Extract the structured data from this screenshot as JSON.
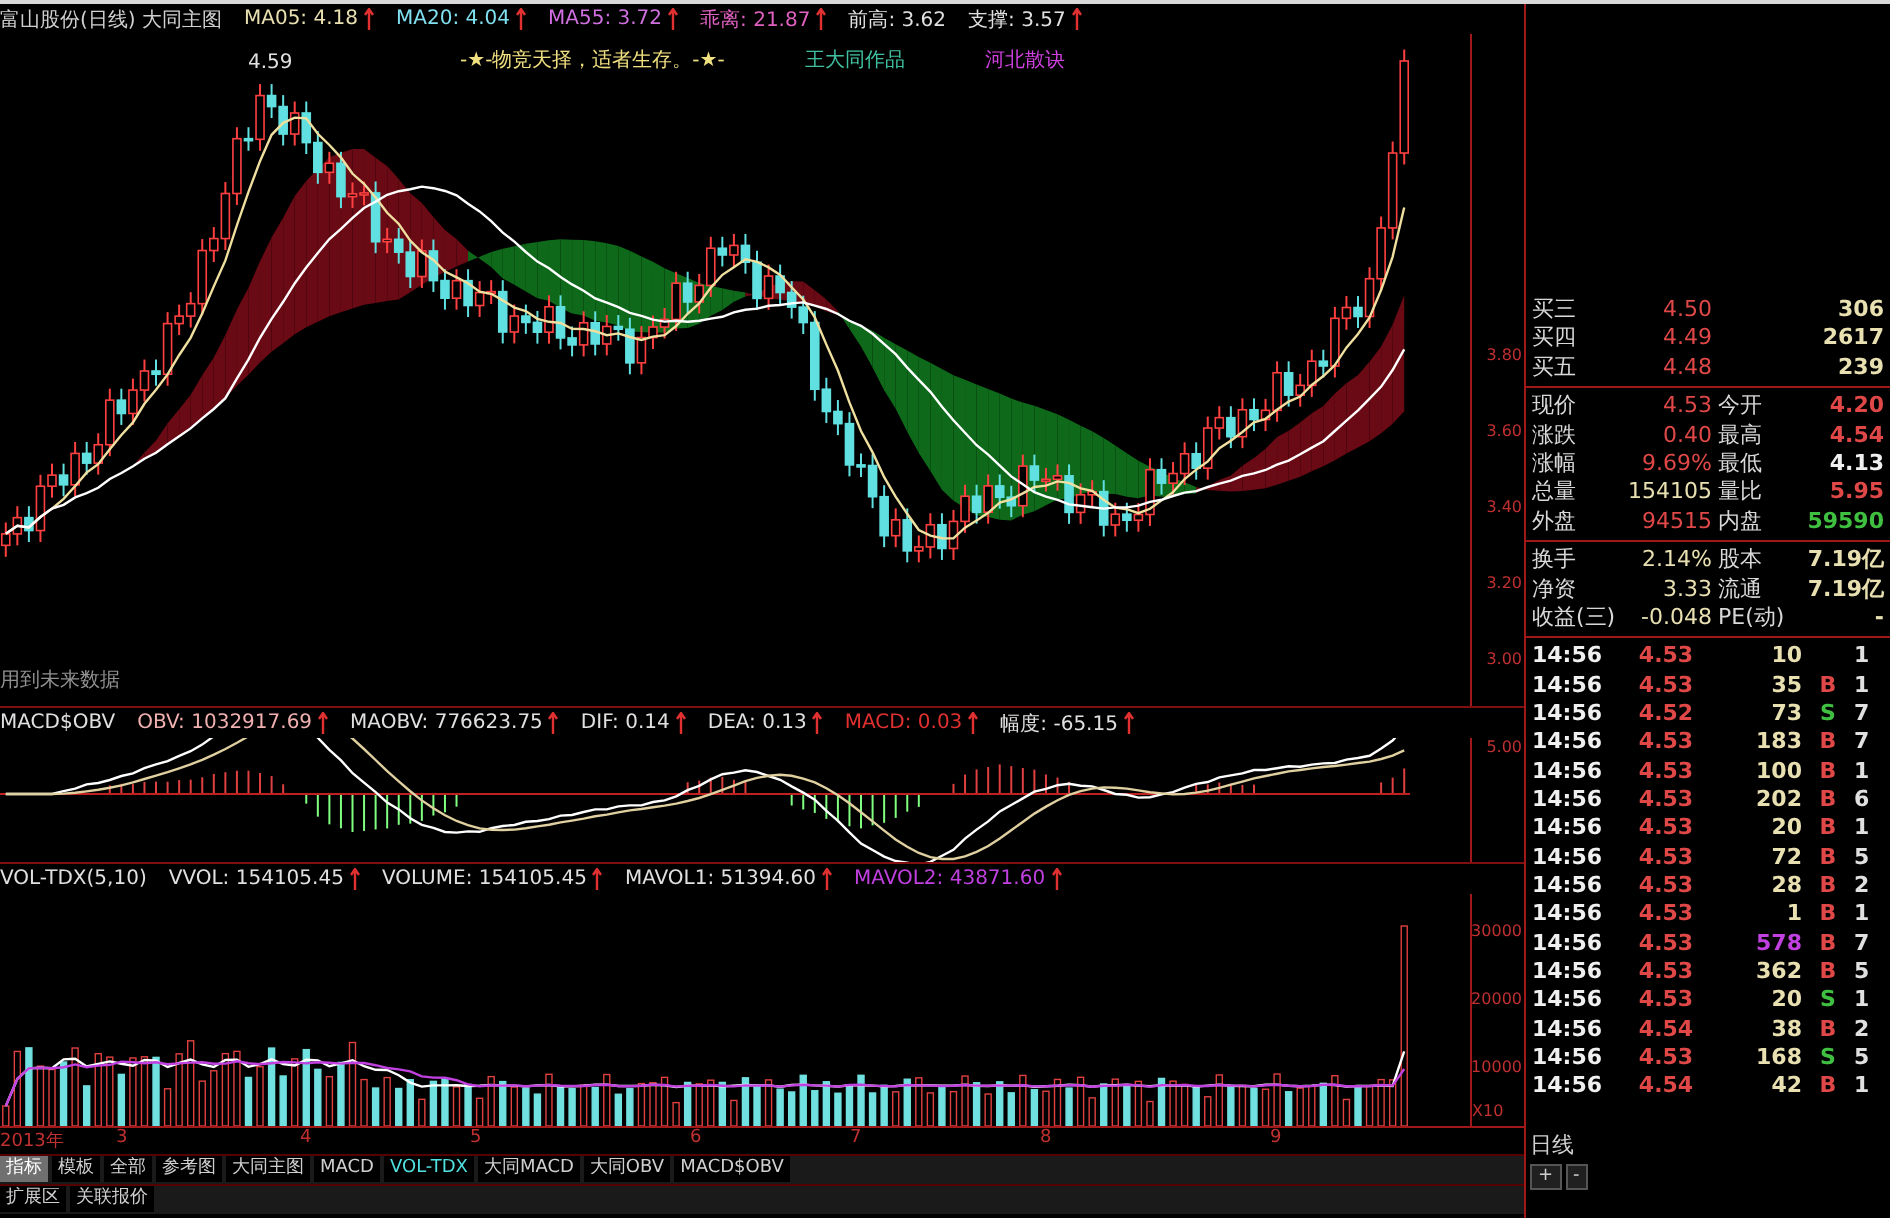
{
  "header": [
    {
      "text": "富山股份(日线) 大同主图",
      "color": "#d0d0d0",
      "arrow": false
    },
    {
      "text": "MA05: 4.18",
      "color": "#e8e0b0",
      "arrow": true
    },
    {
      "text": "MA20: 4.04",
      "color": "#80e0f0",
      "arrow": true
    },
    {
      "text": "MA55: 3.72",
      "color": "#d070e0",
      "arrow": true
    },
    {
      "text": "乖离: 21.87",
      "color": "#e060c0",
      "arrow": true
    },
    {
      "text": "前高: 3.62",
      "color": "#e0e0e0",
      "arrow": false
    },
    {
      "text": "支撑: 3.57",
      "color": "#e0e0e0",
      "arrow": true
    }
  ],
  "slogans": [
    {
      "text": "-★-物竞天择，适者生存。-★-",
      "color": "#f0e080"
    },
    {
      "text": "王大同作品",
      "color": "#40c0a0"
    },
    {
      "text": "河北散诀",
      "color": "#d040e0"
    }
  ],
  "price_chart": {
    "high_label": "4.59",
    "note": "用到未来数据",
    "yticks": [
      "3.80",
      "3.60",
      "3.40",
      "3.20",
      "3.00"
    ]
  },
  "macd_header": [
    {
      "text": "MACD$OBV",
      "color": "#e0e0e0",
      "arrow": false
    },
    {
      "text": "OBV: 1032917.69",
      "color": "#f0b0b0",
      "arrow": true
    },
    {
      "text": "MAOBV: 776623.75",
      "color": "#e0e0e0",
      "arrow": true
    },
    {
      "text": "DIF: 0.14",
      "color": "#e0e0e0",
      "arrow": true
    },
    {
      "text": "DEA: 0.13",
      "color": "#e0e0e0",
      "arrow": true
    },
    {
      "text": "MACD: 0.03",
      "color": "#e03030",
      "arrow": true
    },
    {
      "text": "幅度: -65.15",
      "color": "#e0e0e0",
      "arrow": true
    }
  ],
  "macd_chart": {
    "yticks": [
      "5.00"
    ]
  },
  "vol_header": [
    {
      "text": "VOL-TDX(5,10)",
      "color": "#e0e0e0",
      "arrow": false
    },
    {
      "text": "VVOL: 154105.45",
      "color": "#e0e0e0",
      "arrow": true
    },
    {
      "text": "VOLUME: 154105.45",
      "color": "#e0e0e0",
      "arrow": true
    },
    {
      "text": "MAVOL1: 51394.60",
      "color": "#e0e0e0",
      "arrow": true
    },
    {
      "text": "MAVOL2: 43871.60",
      "color": "#c040e0",
      "arrow": true
    }
  ],
  "vol_chart": {
    "yticks": [
      "30000",
      "20000",
      "10000"
    ],
    "unit": "X10"
  },
  "date_axis": [
    "2013年",
    "3",
    "4",
    "5",
    "6",
    "7",
    "8",
    "9"
  ],
  "tabs": [
    {
      "label": "指标",
      "selected": true,
      "current": false
    },
    {
      "label": "模板",
      "selected": false,
      "current": false
    },
    {
      "label": "全部",
      "selected": false,
      "current": false
    },
    {
      "label": "参考图",
      "selected": false,
      "current": false
    },
    {
      "label": "大同主图",
      "selected": false,
      "current": false
    },
    {
      "label": "MACD",
      "selected": false,
      "current": false
    },
    {
      "label": "VOL-TDX",
      "selected": false,
      "current": true
    },
    {
      "label": "大同MACD",
      "selected": false,
      "current": false
    },
    {
      "label": "大同OBV",
      "selected": false,
      "current": false
    },
    {
      "label": "MACD$OBV",
      "selected": false,
      "current": false
    }
  ],
  "bottom_tabs": [
    {
      "label": "扩展区"
    },
    {
      "label": "关联报价"
    }
  ],
  "quote_groups": [
    [
      {
        "label": "买三",
        "value": {
          "text": "4.50",
          "color": "#e04848"
        },
        "value2": {
          "text": "306",
          "color": "#e8e0b0"
        }
      },
      {
        "label": "买四",
        "value": {
          "text": "4.49",
          "color": "#e04848"
        },
        "value2": {
          "text": "2617",
          "color": "#e8e0b0"
        }
      },
      {
        "label": "买五",
        "value": {
          "text": "4.48",
          "color": "#e04848"
        },
        "value2": {
          "text": "239",
          "color": "#e8e0b0"
        }
      }
    ],
    [
      {
        "label": "现价",
        "value": {
          "text": "4.53",
          "color": "#e04848"
        },
        "label2": "今开",
        "value2": {
          "text": "4.20",
          "color": "#e04848"
        }
      },
      {
        "label": "涨跌",
        "value": {
          "text": "0.40",
          "color": "#e04848"
        },
        "label2": "最高",
        "value2": {
          "text": "4.54",
          "color": "#e04848"
        }
      },
      {
        "label": "涨幅",
        "value": {
          "text": "9.69%",
          "color": "#e04848"
        },
        "label2": "最低",
        "value2": {
          "text": "4.13",
          "color": "#f0f0f0"
        }
      },
      {
        "label": "总量",
        "value": {
          "text": "154105",
          "color": "#e8e0b0"
        },
        "label2": "量比",
        "value2": {
          "text": "5.95",
          "color": "#e04848"
        }
      },
      {
        "label": "外盘",
        "value": {
          "text": "94515",
          "color": "#e04848"
        },
        "label2": "内盘",
        "value2": {
          "text": "59590",
          "color": "#40c040"
        }
      }
    ],
    [
      {
        "label": "换手",
        "value": {
          "text": "2.14%",
          "color": "#e8e0b0"
        },
        "label2": "股本",
        "value2": {
          "text": "7.19亿",
          "color": "#e8e0b0"
        }
      },
      {
        "label": "净资",
        "value": {
          "text": "3.33",
          "color": "#e8e0b0"
        },
        "label2": "流通",
        "value2": {
          "text": "7.19亿",
          "color": "#e8e0b0"
        }
      },
      {
        "label": "收益(三)",
        "value": {
          "text": "-0.048",
          "color": "#e8e0b0"
        },
        "label2": "PE(动)",
        "value2": {
          "text": "-",
          "color": "#e8e0b0"
        }
      }
    ]
  ],
  "ticks": [
    {
      "time": "14:56",
      "price": "4.53",
      "volume": {
        "text": "10",
        "color": "#e8e0b0"
      },
      "column_5": "1"
    },
    {
      "time": "14:56",
      "price": "4.53",
      "volume": {
        "text": "35",
        "color": "#e8e0b0"
      },
      "side": {
        "text": "B",
        "color": "#e04848"
      },
      "column_5": "1"
    },
    {
      "time": "14:56",
      "price": "4.52",
      "volume": {
        "text": "73",
        "color": "#e8e0b0"
      },
      "side": {
        "text": "S",
        "color": "#40c040"
      },
      "column_5": "7"
    },
    {
      "time": "14:56",
      "price": "4.53",
      "volume": {
        "text": "183",
        "color": "#e8e0b0"
      },
      "side": {
        "text": "B",
        "color": "#e04848"
      },
      "column_5": "7"
    },
    {
      "time": "14:56",
      "price": "4.53",
      "volume": {
        "text": "100",
        "color": "#e8e0b0"
      },
      "side": {
        "text": "B",
        "color": "#e04848"
      },
      "column_5": "1"
    },
    {
      "time": "14:56",
      "price": "4.53",
      "volume": {
        "text": "202",
        "color": "#e8e0b0"
      },
      "side": {
        "text": "B",
        "color": "#e04848"
      },
      "column_5": "6"
    },
    {
      "time": "14:56",
      "price": "4.53",
      "volume": {
        "text": "20",
        "color": "#e8e0b0"
      },
      "side": {
        "text": "B",
        "color": "#e04848"
      },
      "column_5": "1"
    },
    {
      "time": "14:56",
      "price": "4.53",
      "volume": {
        "text": "72",
        "color": "#e8e0b0"
      },
      "side": {
        "text": "B",
        "color": "#e04848"
      },
      "column_5": "5"
    },
    {
      "time": "14:56",
      "price": "4.53",
      "volume": {
        "text": "28",
        "color": "#e8e0b0"
      },
      "side": {
        "text": "B",
        "color": "#e04848"
      },
      "column_5": "2"
    },
    {
      "time": "14:56",
      "price": "4.53",
      "volume": {
        "text": "1",
        "color": "#e8e0b0"
      },
      "side": {
        "text": "B",
        "color": "#e04848"
      },
      "column_5": "1"
    },
    {
      "time": "14:56",
      "price": "4.53",
      "volume": {
        "text": "578",
        "color": "#c040e0"
      },
      "side": {
        "text": "B",
        "color": "#e04848"
      },
      "column_5": "7"
    },
    {
      "time": "14:56",
      "price": "4.53",
      "volume": {
        "text": "362",
        "color": "#e8e0b0"
      },
      "side": {
        "text": "B",
        "color": "#e04848"
      },
      "column_5": "5"
    },
    {
      "time": "14:56",
      "price": "4.53",
      "volume": {
        "text": "20",
        "color": "#e8e0b0"
      },
      "side": {
        "text": "S",
        "color": "#40c040"
      },
      "column_5": "1"
    },
    {
      "time": "14:56",
      "price": "4.54",
      "volume": {
        "text": "38",
        "color": "#e8e0b0"
      },
      "side": {
        "text": "B",
        "color": "#e04848"
      },
      "column_5": "2"
    },
    {
      "time": "14:56",
      "price": "4.53",
      "volume": {
        "text": "168",
        "color": "#e8e0b0"
      },
      "side": {
        "text": "S",
        "color": "#40c040"
      },
      "column_5": "5"
    },
    {
      "time": "14:56",
      "price": "4.54",
      "volume": {
        "text": "42",
        "color": "#e8e0b0"
      },
      "side": {
        "text": "B",
        "color": "#e04848"
      },
      "column_5": "1"
    }
  ],
  "period": {
    "label": "日线"
  },
  "zoom_buttons": [
    "+",
    "-"
  ]
}
